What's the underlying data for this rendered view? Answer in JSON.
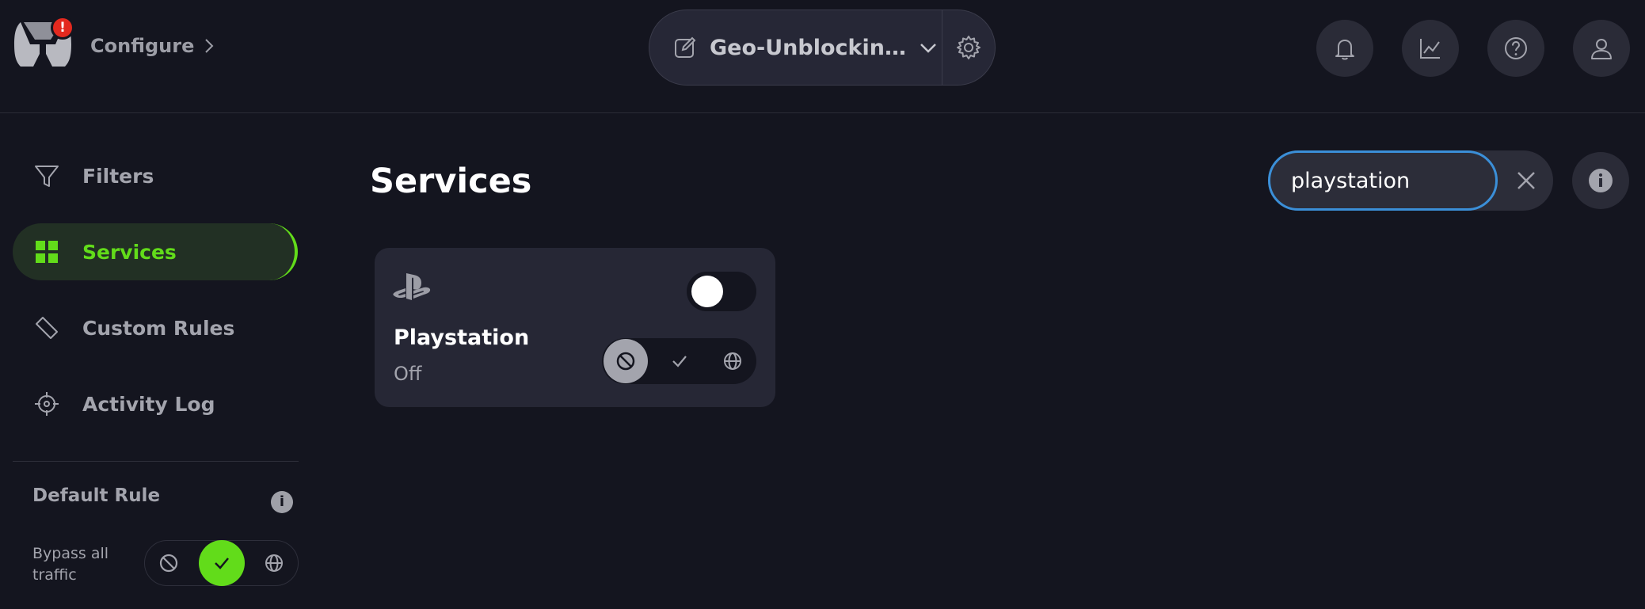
{
  "header": {
    "alert_badge": "!",
    "breadcrumb": "Configure",
    "profile_name": "Geo-Unblockin…"
  },
  "sidebar": {
    "items": [
      {
        "label": "Filters",
        "icon": "filter-icon"
      },
      {
        "label": "Services",
        "icon": "grid-icon",
        "active": true
      },
      {
        "label": "Custom Rules",
        "icon": "ruler-icon"
      },
      {
        "label": "Activity Log",
        "icon": "crosshair-icon"
      }
    ],
    "default_rule": {
      "title": "Default Rule",
      "info": "i",
      "description": "Bypass all traffic",
      "options": [
        "block",
        "bypass",
        "redirect"
      ],
      "selected": "bypass"
    }
  },
  "main": {
    "title": "Services",
    "search": {
      "value": "playstation"
    },
    "info": "i",
    "services": [
      {
        "name": "Playstation",
        "status": "Off",
        "enabled": false,
        "selected_action": "block"
      }
    ]
  },
  "colors": {
    "background": "#14151f",
    "accent_green": "#62dc1a",
    "focus_blue": "#3b8fd8",
    "alert_red": "#e3291f"
  }
}
